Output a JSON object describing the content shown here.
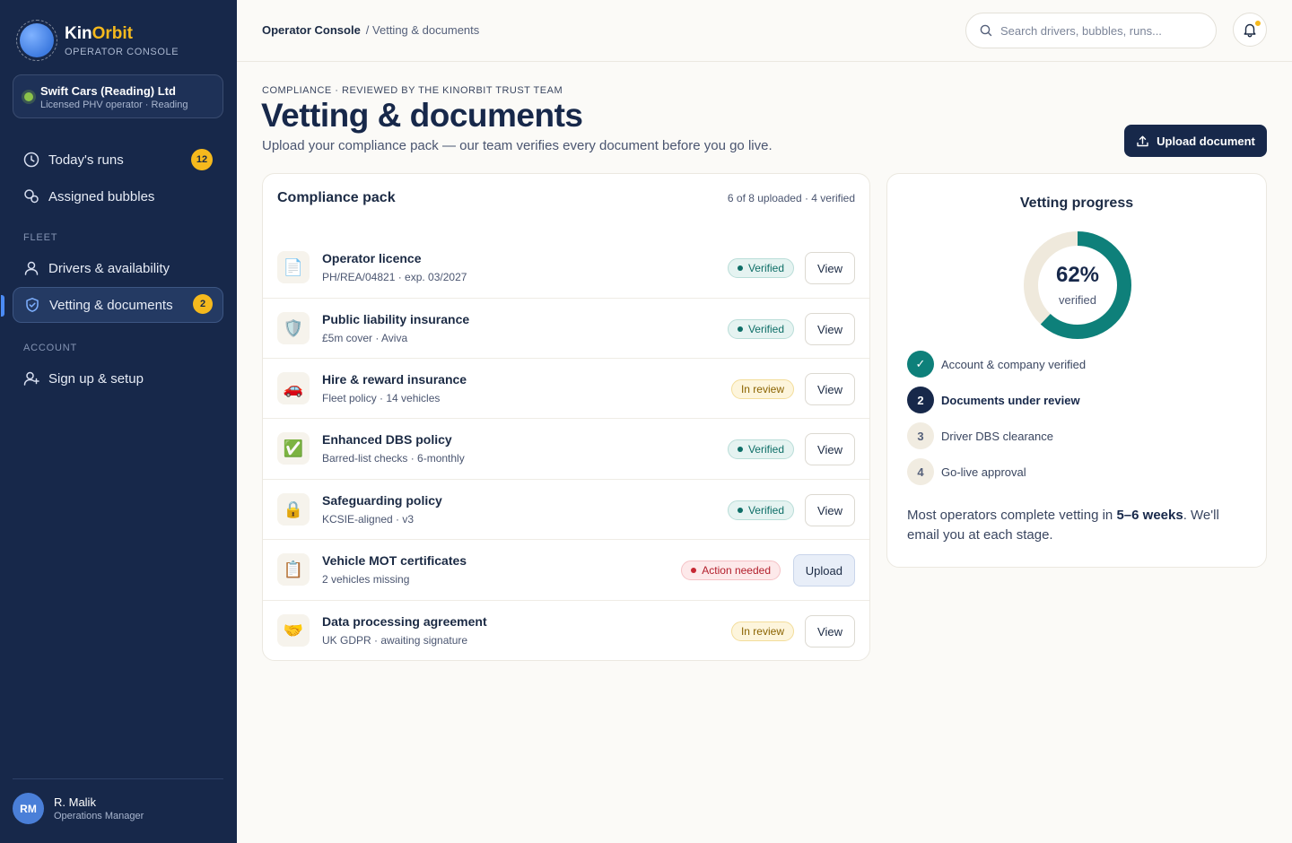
{
  "brand": {
    "name_part1": "Kin",
    "name_part2": "Orbit",
    "subtitle": "OPERATOR CONSOLE"
  },
  "organization": {
    "name": "Swift Cars (Reading) Ltd",
    "subtitle": "Licensed PHV operator · Reading"
  },
  "nav": {
    "items": [
      {
        "label": "Today's runs",
        "badge": "12",
        "icon": "clock-icon"
      },
      {
        "label": "Assigned bubbles",
        "icon": "bubbles-icon"
      },
      {
        "label": "Drivers & availability",
        "icon": "user-icon"
      },
      {
        "label": "Vetting & documents",
        "badge": "2",
        "icon": "shield-check-icon",
        "active": true
      },
      {
        "label": "Sign up & setup",
        "icon": "user-plus-icon"
      }
    ],
    "sections": {
      "fleet": "FLEET",
      "account": "ACCOUNT"
    }
  },
  "user": {
    "initials": "RM",
    "name": "R. Malik",
    "role": "Operations Manager"
  },
  "topbar": {
    "breadcrumb_root": "Operator Console",
    "breadcrumb_current": "/ Vetting & documents",
    "search_placeholder": "Search drivers, bubbles, runs..."
  },
  "header": {
    "eyebrow": "COMPLIANCE · REVIEWED BY THE KINORBIT TRUST TEAM",
    "title": "Vetting & documents",
    "description": "Upload your compliance pack — our team verifies every document before you go live.",
    "upload_button": "Upload document"
  },
  "compliance": {
    "title": "Compliance pack",
    "meta": "6 of 8 uploaded · 4 verified",
    "documents": [
      {
        "name": "Operator licence",
        "detail": "PH/REA/04821 · exp. 03/2027",
        "icon": "document-icon",
        "glyph": "📄",
        "status": "Verified",
        "status_type": "verified",
        "action": "View"
      },
      {
        "name": "Public liability insurance",
        "detail": "£5m cover · Aviva",
        "icon": "shield-icon",
        "glyph": "🛡️",
        "status": "Verified",
        "status_type": "verified",
        "action": "View"
      },
      {
        "name": "Hire & reward insurance",
        "detail": "Fleet policy · 14 vehicles",
        "icon": "car-icon",
        "glyph": "🚗",
        "status": "In review",
        "status_type": "review",
        "action": "View"
      },
      {
        "name": "Enhanced DBS policy",
        "detail": "Barred-list checks · 6-monthly",
        "icon": "check-box-icon",
        "glyph": "✅",
        "status": "Verified",
        "status_type": "verified",
        "action": "View"
      },
      {
        "name": "Safeguarding policy",
        "detail": "KCSIE-aligned · v3",
        "icon": "lock-icon",
        "glyph": "🔒",
        "status": "Verified",
        "status_type": "verified",
        "action": "View"
      },
      {
        "name": "Vehicle MOT certificates",
        "detail": "2 vehicles missing",
        "icon": "clipboard-icon",
        "glyph": "📋",
        "status": "Action needed",
        "status_type": "action",
        "action": "Upload"
      },
      {
        "name": "Data processing agreement",
        "detail": "UK GDPR · awaiting signature",
        "icon": "handshake-icon",
        "glyph": "🤝",
        "status": "In review",
        "status_type": "review",
        "action": "View"
      }
    ]
  },
  "progress": {
    "title": "Vetting progress",
    "percent": 62,
    "percent_label": "62%",
    "ring_label": "verified",
    "steps": [
      {
        "marker": "✓",
        "label": "Account & company verified",
        "state": "done"
      },
      {
        "marker": "2",
        "label": "Documents under review",
        "state": "current"
      },
      {
        "marker": "3",
        "label": "Driver DBS clearance",
        "state": "todo"
      },
      {
        "marker": "4",
        "label": "Go-live approval",
        "state": "todo"
      }
    ],
    "note_before": "Most operators complete vetting in ",
    "note_bold": "5–6 weeks",
    "note_after": ". We'll email you at each stage."
  },
  "colors": {
    "sidebar": "#17284a",
    "accent": "#f5b91d",
    "teal": "#0e807a",
    "ring_track": "#efe9dc"
  }
}
